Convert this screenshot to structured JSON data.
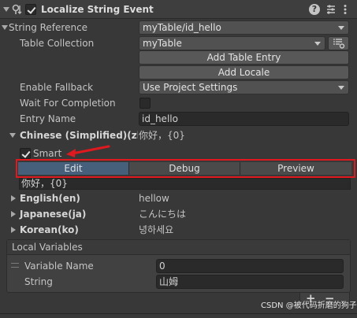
{
  "header": {
    "title": "Localize String Event",
    "enabled": true
  },
  "string_reference": {
    "label": "String Reference",
    "value": "myTable/id_hello"
  },
  "table_collection": {
    "label": "Table Collection",
    "value": "myTable"
  },
  "buttons": {
    "add_table_entry": "Add Table Entry",
    "add_locale": "Add Locale"
  },
  "enable_fallback": {
    "label": "Enable Fallback",
    "value": "Use Project Settings"
  },
  "wait_for_completion": {
    "label": "Wait For Completion",
    "checked": false
  },
  "entry_name": {
    "label": "Entry Name",
    "value": "id_hello"
  },
  "locales": [
    {
      "name": "Chinese (Simplified)(zl",
      "value": "你好，{0}",
      "expanded": true
    },
    {
      "name": "English(en)",
      "value": "hellow",
      "expanded": false
    },
    {
      "name": "Japanese(ja)",
      "value": "こんにちは",
      "expanded": false
    },
    {
      "name": "Korean(ko)",
      "value": "녕하세요",
      "expanded": false
    }
  ],
  "smart": {
    "label": "Smart",
    "checked": true
  },
  "editor_tabs": [
    {
      "label": "Edit",
      "active": true
    },
    {
      "label": "Debug",
      "active": false
    },
    {
      "label": "Preview",
      "active": false
    }
  ],
  "edit_text": "你好，{0}",
  "local_variables": {
    "title": "Local Variables",
    "variables": [
      {
        "label": "Variable Name",
        "value": "0"
      },
      {
        "label": "String",
        "value": "山姆"
      }
    ],
    "add_label": "+",
    "remove_label": "−"
  },
  "watermark": "CSDN @被代码折磨的狗子",
  "colors": {
    "highlight_red": "#e0191e",
    "active_tab": "#46607c",
    "background": "#383838"
  }
}
